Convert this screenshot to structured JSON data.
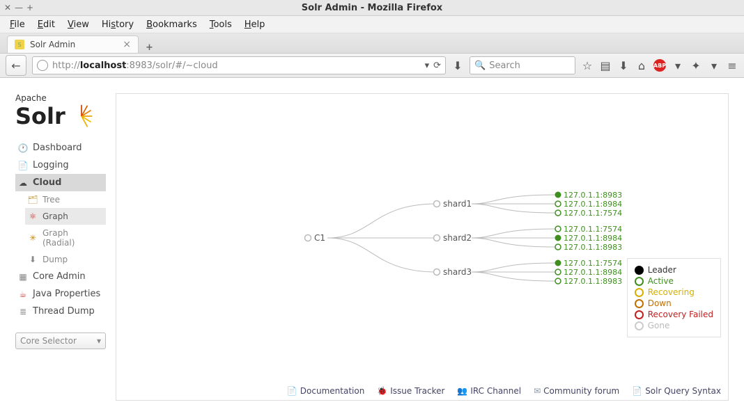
{
  "window_title": "Solr Admin - Mozilla Firefox",
  "menubar": [
    "File",
    "Edit",
    "View",
    "History",
    "Bookmarks",
    "Tools",
    "Help"
  ],
  "tab": {
    "title": "Solr Admin"
  },
  "url": {
    "prefix": "http://",
    "host": "localhost",
    "rest": ":8983/solr/#/~cloud"
  },
  "search": {
    "placeholder": "Search"
  },
  "logo": {
    "top": "Apache",
    "bottom": "Solr"
  },
  "nav": {
    "dashboard": "Dashboard",
    "logging": "Logging",
    "cloud": "Cloud",
    "tree": "Tree",
    "graph": "Graph",
    "graph_radial": "Graph (Radial)",
    "dump": "Dump",
    "core_admin": "Core Admin",
    "java_props": "Java Properties",
    "thread_dump": "Thread Dump",
    "core_selector": "Core Selector"
  },
  "graph": {
    "root": "C1",
    "shards": [
      {
        "name": "shard1",
        "replicas": [
          {
            "addr": "127.0.1.1:8983",
            "status": "leader"
          },
          {
            "addr": "127.0.1.1:8984",
            "status": "active"
          },
          {
            "addr": "127.0.1.1:7574",
            "status": "active"
          }
        ]
      },
      {
        "name": "shard2",
        "replicas": [
          {
            "addr": "127.0.1.1:7574",
            "status": "active"
          },
          {
            "addr": "127.0.1.1:8984",
            "status": "leader"
          },
          {
            "addr": "127.0.1.1:8983",
            "status": "active"
          }
        ]
      },
      {
        "name": "shard3",
        "replicas": [
          {
            "addr": "127.0.1.1:7574",
            "status": "leader"
          },
          {
            "addr": "127.0.1.1:8984",
            "status": "active"
          },
          {
            "addr": "127.0.1.1:8983",
            "status": "active"
          }
        ]
      }
    ]
  },
  "legend": [
    {
      "label": "Leader",
      "fill": "#000",
      "stroke": "#000"
    },
    {
      "label": "Active",
      "fill": "#fff",
      "stroke": "#3f8f1f",
      "color": "#3f8f1f"
    },
    {
      "label": "Recovering",
      "fill": "#fff",
      "stroke": "#d6b000",
      "color": "#d6b000"
    },
    {
      "label": "Down",
      "fill": "#fff",
      "stroke": "#c07000",
      "color": "#c07000"
    },
    {
      "label": "Recovery Failed",
      "fill": "#fff",
      "stroke": "#c02020",
      "color": "#c02020"
    },
    {
      "label": "Gone",
      "fill": "#fff",
      "stroke": "#ccc",
      "color": "#bbb"
    }
  ],
  "footer": [
    {
      "label": "Documentation",
      "icon": "📄",
      "color": "#3a7"
    },
    {
      "label": "Issue Tracker",
      "icon": "🐞",
      "color": "#4a3"
    },
    {
      "label": "IRC Channel",
      "icon": "👥",
      "color": "#a53"
    },
    {
      "label": "Community forum",
      "icon": "✉",
      "color": "#89a"
    },
    {
      "label": "Solr Query Syntax",
      "icon": "📄",
      "color": "#3a7"
    }
  ]
}
